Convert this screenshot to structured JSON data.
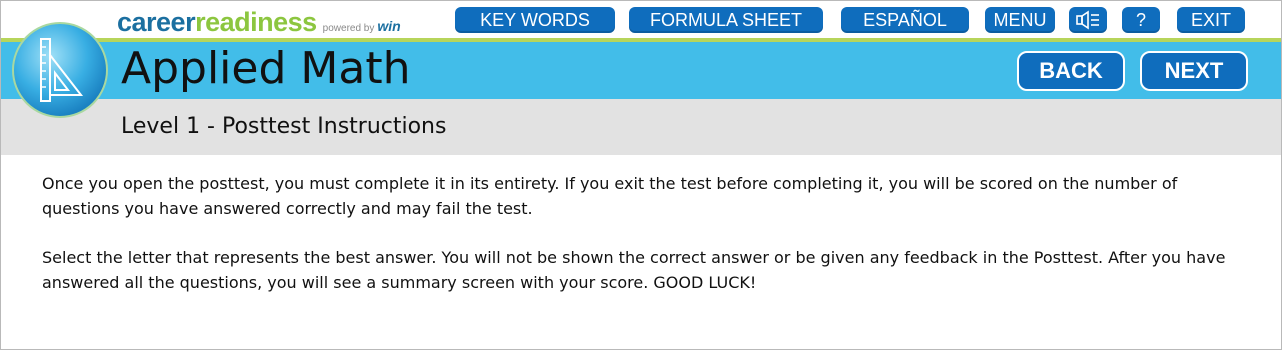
{
  "brand": {
    "career": "career",
    "readiness": "readiness",
    "powered_by": "powered by",
    "win": "win"
  },
  "toolbar": {
    "key_words": "KEY WORDS",
    "formula_sheet": "FORMULA SHEET",
    "espanol": "ESPAÑOL",
    "menu": "MENU",
    "help": "?",
    "exit": "EXIT",
    "speaker_icon": "speaker-mute-icon"
  },
  "header": {
    "title": "Applied Math",
    "back": "BACK",
    "next": "NEXT",
    "subtitle": "Level 1 - Posttest Instructions",
    "logo_icon": "triangle-ruler-icon"
  },
  "content": {
    "paragraph1": "Once you open the posttest, you must complete it in its entirety. If you exit the test before completing it, you will be scored on the number of questions you have answered correctly and may fail the test.",
    "paragraph2": "Select the letter that represents the best answer. You will not be shown the correct answer or be given any feedback in the Posttest. After you have answered all the questions, you will see a summary screen with your score. GOOD LUCK!"
  },
  "colors": {
    "brand_blue": "#1b6fa0",
    "brand_green": "#8cc63f",
    "button_blue": "#0f6dbd",
    "band_blue": "#42bde9",
    "band_grey": "#e2e2e2"
  }
}
